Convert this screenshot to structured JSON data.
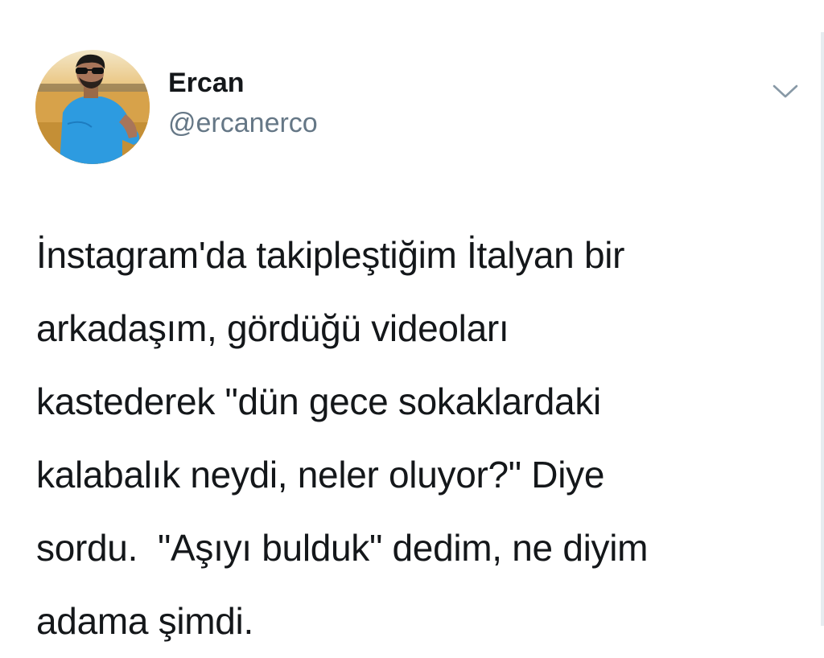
{
  "author": {
    "display_name": "Ercan",
    "handle": "@ercanerco",
    "avatar_icon": "profile-photo"
  },
  "menu": {
    "icon": "chevron-down-icon"
  },
  "tweet": {
    "text": "İnstagram'da takipleştiğim İtalyan bir\narkadaşım, gördüğü videoları\nkastederek \"dün gece sokaklardaki\nkalabalık neydi, neler oluyor?\" Diye\nsordu.  \"Aşıyı bulduk\" dedim, ne diyim\nadama şimdi."
  },
  "colors": {
    "text_primary": "#14171a",
    "text_secondary": "#657786",
    "caret": "#8899a6",
    "shirt": "#2d9be0",
    "background_field": "#d9a94a"
  }
}
